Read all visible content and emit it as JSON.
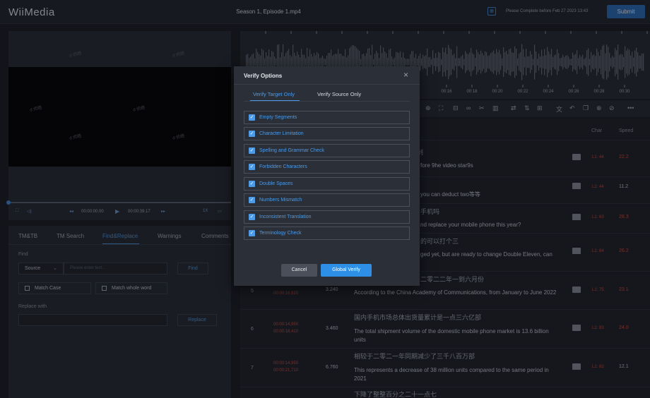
{
  "header": {
    "logo": "WiiMedia",
    "file_title": "Season 1, Episode 1.mp4",
    "deadline_icon": "calendar-icon",
    "deadline_text": "Please Complete before Feb 27 2023 13:43",
    "submit_label": "Submit"
  },
  "player": {
    "watermark": "d 侦晒",
    "current_time": "00:00:00.00",
    "total_time": "00:00:39.17",
    "speed": "1X",
    "progress_fraction": 0.0
  },
  "tabs": [
    {
      "label": "TM&TB"
    },
    {
      "label": "TM Search"
    },
    {
      "label": "Find&Replace",
      "active": true
    },
    {
      "label": "Warnings"
    },
    {
      "label": "Comments"
    }
  ],
  "find": {
    "label": "Find",
    "source_select": "Source",
    "placeholder": "Please enter text...",
    "find_button": "Find",
    "match_case": "Match Case",
    "match_whole_word": "Match whole word",
    "replace_label": "Replace with",
    "replace_button": "Replace"
  },
  "waveform": {
    "ticks": [
      "00:16",
      "00:18",
      "00:20",
      "00:22",
      "00:24",
      "00:26",
      "00:28",
      "00:30"
    ]
  },
  "table": {
    "headers": {
      "char": "Char",
      "speed": "Speed"
    },
    "partial_rows": [
      {
        "src_tail": "剁",
        "tgt_tail": "fore 9he video star9s",
        "char": "L1: 44",
        "speed": "22.2"
      },
      {
        "src_tail": "",
        "tgt_tail": "you can deduct two等等",
        "char": "L1: 44",
        "speed": "11.2"
      },
      {
        "src_tail": "手机吗",
        "tgt_tail": "nd replace your mobile phone this year?",
        "char": "L1: 63",
        "speed": "28.3"
      },
      {
        "src_tail": "的可以打个三",
        "tgt_tail": "ged yet, but are ready to change Double Eleven, can",
        "char": "L1: 84",
        "speed": "26.2"
      },
      {
        "src_tail": "二零二二年一到六月份",
        "tgt_tail": "",
        "char": "",
        "speed": ""
      }
    ],
    "rows": [
      {
        "num": "5",
        "t2": "00:00:16,920",
        "dur": "3.240",
        "tgt": "According to the China Academy of Communications, from January to June 2022",
        "char": "L1: 75",
        "speed": "23.1"
      },
      {
        "num": "6",
        "t1": "00:00:14,950",
        "t2": "00:00:18,410",
        "dur": "3.460",
        "src": "国内手机市场总体出货量累计是一点三六亿部",
        "tgt": "The total shipment volume of the domestic mobile phone market is 13.6 billion units",
        "char": "L1: 83",
        "speed": "24.0"
      },
      {
        "num": "7",
        "t1": "00:00:14,950",
        "t2": "00:00:21,710",
        "dur": "6.760",
        "src": "相较于二零二一年同期减少了三千八百万部",
        "tgt": "This represents a decrease of 38 million units compared to the same period in 2021",
        "char": "L1: 82",
        "speed": "12.1"
      },
      {
        "src": "下降了整整百分之二十一点七"
      }
    ]
  },
  "modal": {
    "title": "Verify Options",
    "tab_target": "Verify Target Only",
    "tab_source": "Verify Source Only",
    "options": [
      "Empty Segments",
      "Character Limitation",
      "Spelling and Grammar Check",
      "Forbidden Characters",
      "Double Spaces",
      "Numbers Mismatch",
      "Inconsistent Translation",
      "Terminology Check"
    ],
    "cancel": "Cancel",
    "verify": "Global Verify"
  },
  "colors": {
    "accent": "#4d9be6",
    "submit": "#2b6fc0",
    "warning": "#d04a3e",
    "bg": "#1a1d24"
  }
}
